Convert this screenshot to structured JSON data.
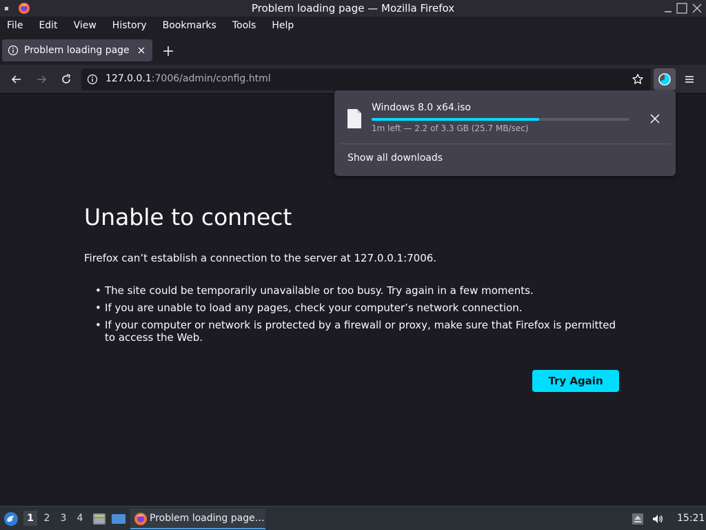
{
  "window": {
    "title": "Problem loading page — Mozilla Firefox"
  },
  "menubar": {
    "items": [
      "File",
      "Edit",
      "View",
      "History",
      "Bookmarks",
      "Tools",
      "Help"
    ]
  },
  "tab": {
    "label": "Problem loading page"
  },
  "urlbar": {
    "host": "127.0.0.1",
    "rest": ":7006/admin/config.html"
  },
  "error": {
    "title": "Unable to connect",
    "description": "Firefox can’t establish a connection to the server at 127.0.0.1:7006.",
    "bullets": [
      "The site could be temporarily unavailable or too busy. Try again in a few moments.",
      "If you are unable to load any pages, check your computer’s network connection.",
      "If your computer or network is protected by a firewall or proxy, make sure that Firefox is permitted to access the Web."
    ],
    "try_again_label": "Try Again"
  },
  "downloads": {
    "file_name": "Windows 8.0 x64.iso",
    "progress_fraction": 0.65,
    "status": "1m left — 2.2 of 3.3 GB (25.7 MB/sec)",
    "show_all_label": "Show all downloads"
  },
  "taskbar": {
    "workspaces": [
      "1",
      "2",
      "3",
      "4"
    ],
    "active_workspace": "1",
    "task_label": "Problem loading page…",
    "clock": "15:21"
  },
  "colors": {
    "accent": "#00ddff",
    "page_bg": "#1c1b22",
    "toolbar_bg": "#2b2a33",
    "panel_bg": "#42414d"
  }
}
